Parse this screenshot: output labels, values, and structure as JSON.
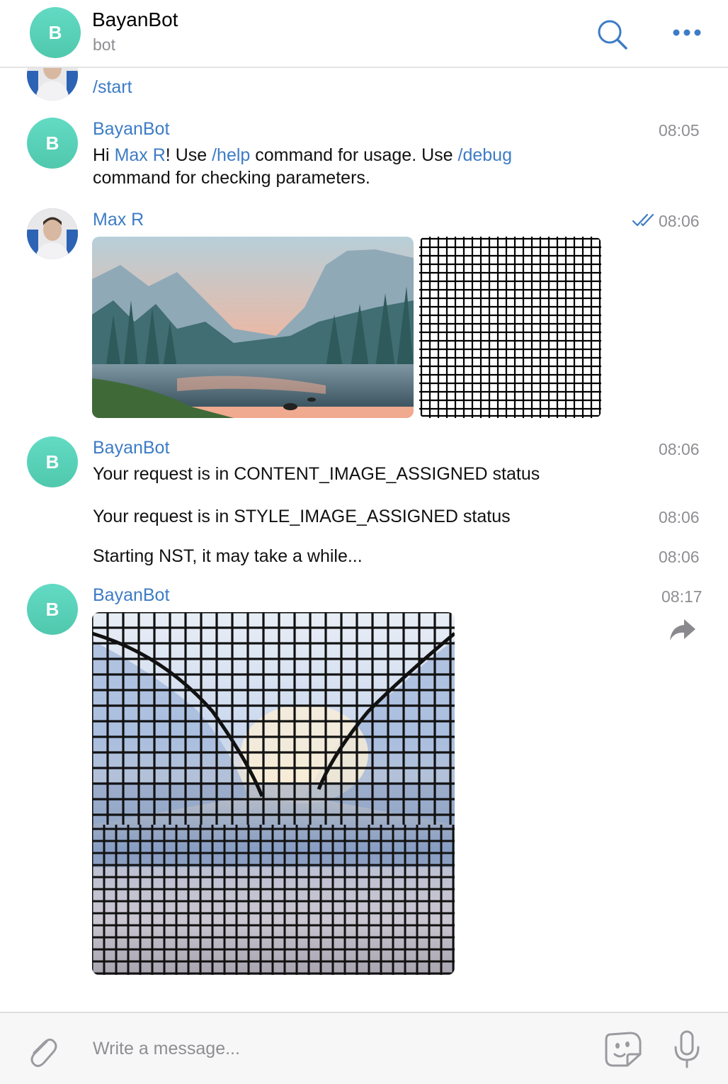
{
  "header": {
    "avatar_letter": "B",
    "title": "BayanBot",
    "subtitle": "bot",
    "search_icon": "search-icon",
    "more_icon": "more-dots-icon"
  },
  "messages": [
    {
      "sender": "",
      "text": "/start",
      "time": ""
    },
    {
      "sender": "BayanBot",
      "avatar_letter": "B",
      "time": "08:05",
      "parts": [
        "Hi ",
        "Max R",
        "! Use ",
        "/help",
        " command for usage. Use ",
        "/debug",
        " command for checking parameters."
      ]
    },
    {
      "sender": "Max R",
      "time": "08:06",
      "status_icon": "double-check-icon",
      "attachments": [
        "content-image",
        "style-image"
      ]
    },
    {
      "sender": "BayanBot",
      "avatar_letter": "B",
      "time": "08:06",
      "text": "Your request is in CONTENT_IMAGE_ASSIGNED status"
    },
    {
      "text": "Your request is in STYLE_IMAGE_ASSIGNED status",
      "time": "08:06"
    },
    {
      "text": "Starting NST, it may take a while...",
      "time": "08:06"
    },
    {
      "sender": "BayanBot",
      "avatar_letter": "B",
      "time": "08:17",
      "forward_icon": "forward-icon",
      "attachments": [
        "result-image"
      ]
    }
  ],
  "composer": {
    "placeholder": "Write a message...",
    "attach_icon": "paperclip-icon",
    "sticker_icon": "sticker-icon",
    "mic_icon": "microphone-icon"
  },
  "colors": {
    "link": "#3d7cc5",
    "avatar_gradient": "#5ed3bb",
    "secondary": "#8e8e93"
  }
}
